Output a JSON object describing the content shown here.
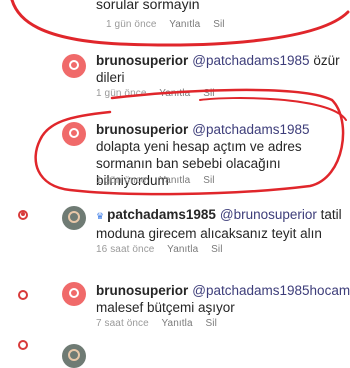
{
  "comments": [
    {
      "text": "sorular sormayin",
      "time": "1 gün önce",
      "reply": "Yanıtla",
      "delete": "Sil"
    },
    {
      "user": "brunosuperior",
      "mention": "@patchadams1985",
      "text": "özür dileri",
      "time": "1 gün önce",
      "reply": "Yanıtla",
      "delete": "Sil"
    },
    {
      "user": "brunosuperior",
      "mention": "@patchadams1985",
      "text": "dolapta yeni hesap açtım ve adres sormanın ban sebebi olacağını bilmiyordum",
      "time": "1 gün önce",
      "reply": "Yanıtla",
      "delete": "Sil"
    },
    {
      "user": "patchadams1985",
      "mention": "@brunosuperior",
      "text": "tatil moduna girecem alıcaksanız teyit alın",
      "time": "16 saat önce",
      "reply": "Yanıtla",
      "delete": "Sil"
    },
    {
      "user": "brunosuperior",
      "mention": "@patchadams1985hocam",
      "text": "malesef bütçemi aşıyor",
      "time": "7 saat önce",
      "reply": "Yanıtla",
      "delete": "Sil"
    }
  ],
  "colors": {
    "avatar": "#f06a6a",
    "annotation": "#e0262b",
    "mention": "#3d3d7a"
  }
}
